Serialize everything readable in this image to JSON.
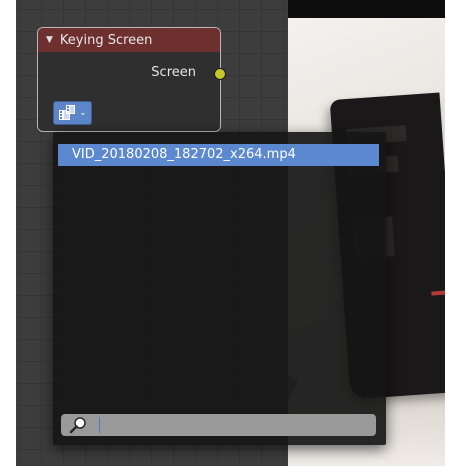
{
  "node": {
    "title": "Keying Screen",
    "output_label": "Screen",
    "collapse_icon": "triangle-down-icon",
    "clip_icon": "movie-clip-icon",
    "socket_color": "#c8c62e",
    "header_color": "#6e2f2f"
  },
  "dropdown": {
    "items": [
      {
        "label": "VID_20180208_182702_x264.mp4",
        "selected": true
      }
    ],
    "search": {
      "value": "",
      "placeholder": "",
      "icon": "magnifier-icon"
    }
  },
  "colors": {
    "accent": "#5b88cf",
    "editor_bg": "#3d3d3d"
  }
}
